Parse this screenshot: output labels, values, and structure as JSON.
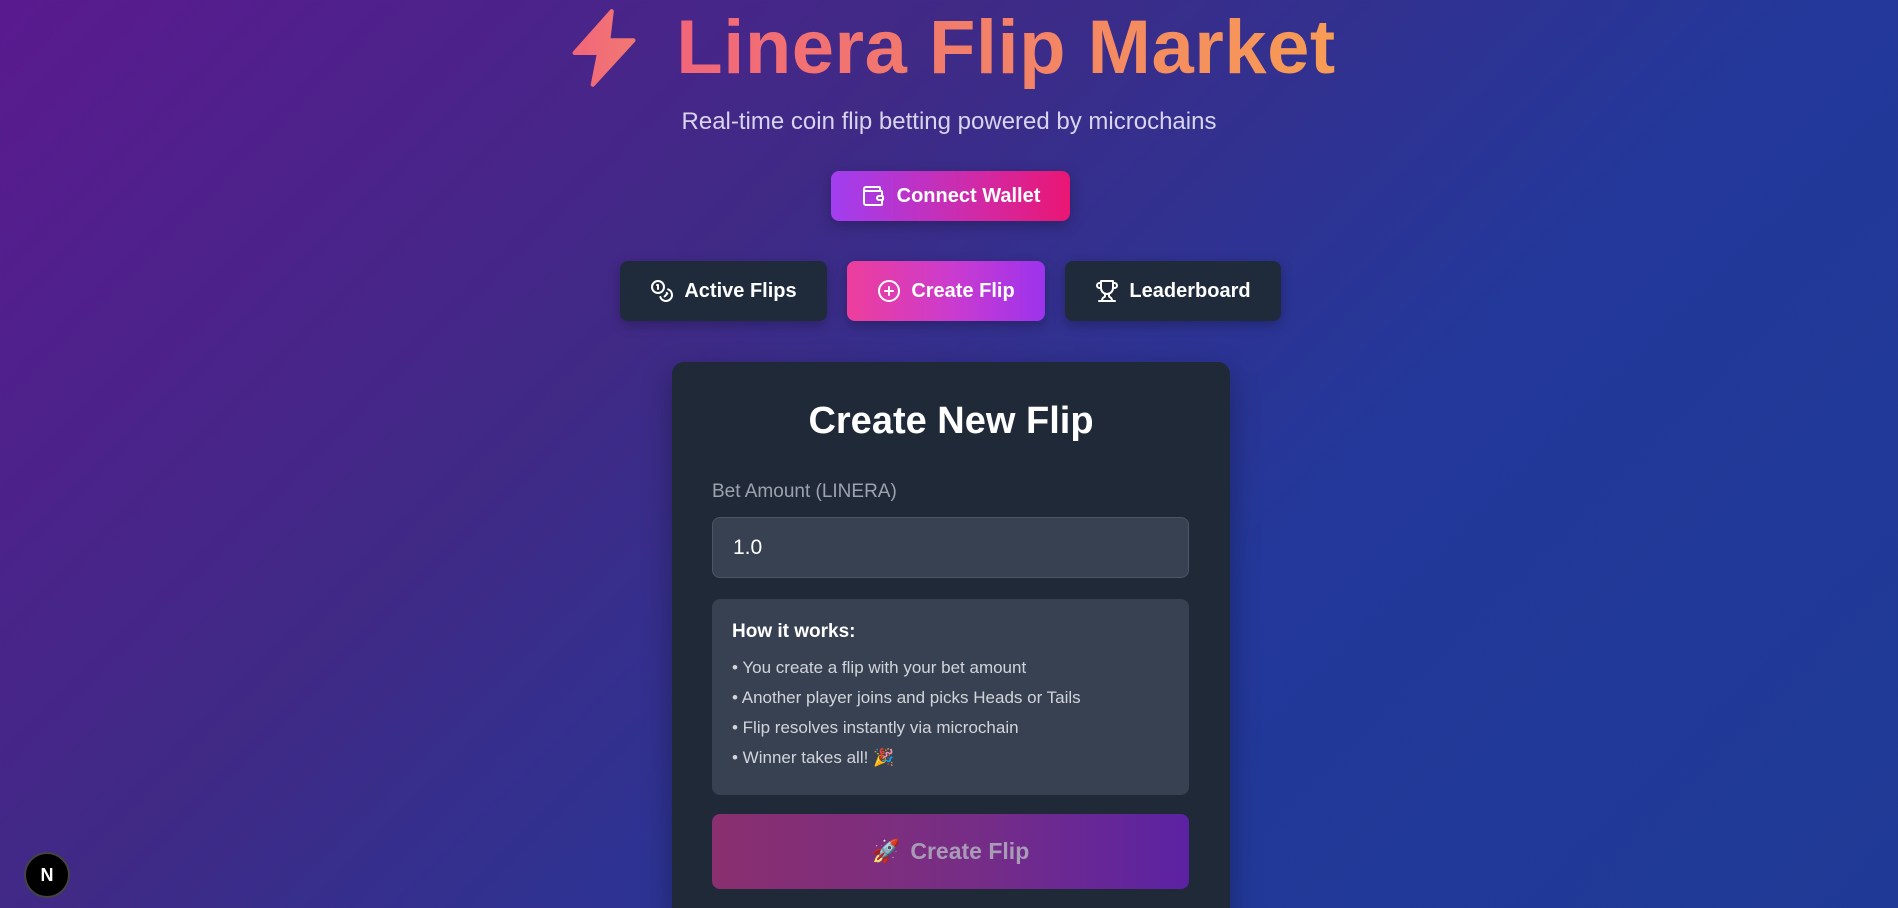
{
  "header": {
    "title": "Linera Flip Market",
    "subtitle": "Real-time coin flip betting powered by microchains",
    "icon": "lightning-bolt-icon"
  },
  "wallet": {
    "connect_label": "Connect Wallet",
    "icon": "wallet-icon"
  },
  "tabs": [
    {
      "label": "Active Flips",
      "icon": "coins-icon",
      "active": false
    },
    {
      "label": "Create Flip",
      "icon": "plus-circle-icon",
      "active": true
    },
    {
      "label": "Leaderboard",
      "icon": "trophy-icon",
      "active": false
    }
  ],
  "create_form": {
    "title": "Create New Flip",
    "bet_label": "Bet Amount (LINERA)",
    "bet_value": "1.0",
    "info": {
      "title": "How it works:",
      "items": [
        "• You create a flip with your bet amount",
        "• Another player joins and picks Heads or Tails",
        "• Flip resolves instantly via microchain",
        "• Winner takes all! 🎉"
      ]
    },
    "submit_label": "Create Flip",
    "submit_icon": "rocket-icon"
  },
  "dev_badge": {
    "label": "N"
  },
  "colors": {
    "title_gradient_start": "#f1667a",
    "title_gradient_end": "#f79c55",
    "card_bg": "#1f2937",
    "tab_bg": "#1f2a3a",
    "accent_pink": "#ee3e9c",
    "accent_purple": "#9c33ec"
  }
}
